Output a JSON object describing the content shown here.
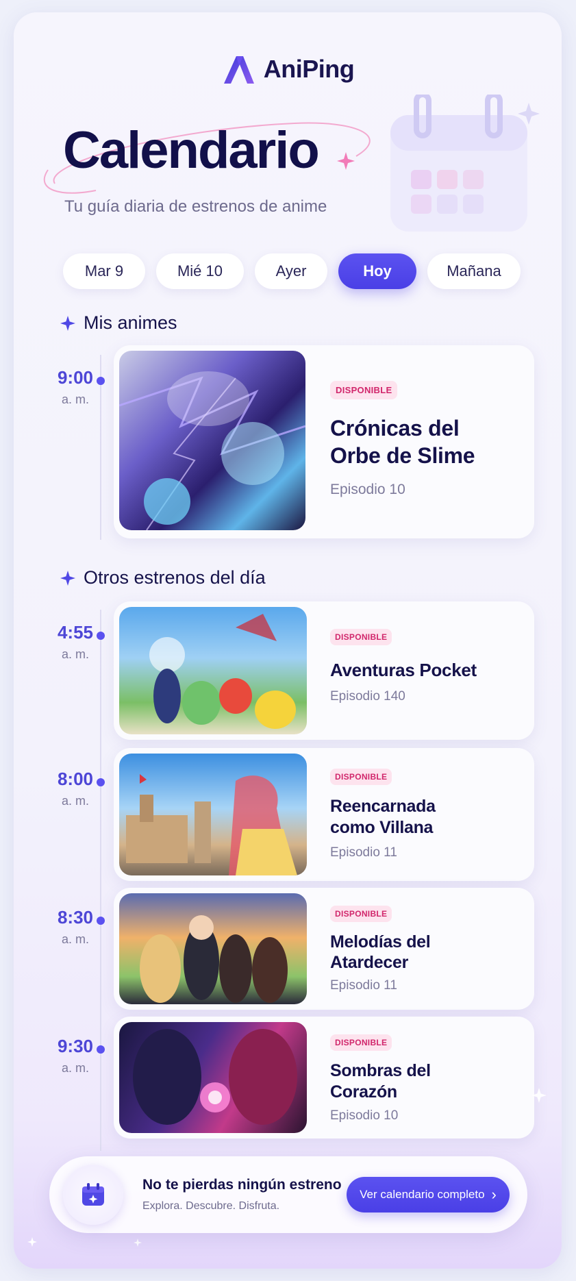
{
  "app": {
    "name": "AniPing"
  },
  "header": {
    "title": "Calendario",
    "subtitle": "Tu guía diaria de estrenos de anime"
  },
  "tabs": [
    {
      "label": "Mar 9",
      "active": false
    },
    {
      "label": "Mié 10",
      "active": false
    },
    {
      "label": "Ayer",
      "active": false
    },
    {
      "label": "Hoy",
      "active": true
    },
    {
      "label": "Mañana",
      "active": false
    }
  ],
  "sections": {
    "mine": "Mis animes",
    "others": "Otros estrenos del día"
  },
  "featured": {
    "time": "9:00",
    "meridiem": "a. m.",
    "badge": "DISPONIBLE",
    "title_line1": "Crónicas del",
    "title_line2": "Orbe de Slime",
    "episode": "Episodio 10"
  },
  "entries": [
    {
      "time": "4:55",
      "meridiem": "a. m.",
      "badge": "DISPONIBLE",
      "title_line1": "Aventuras Pocket",
      "title_line2": "",
      "episode": "Episodio 140"
    },
    {
      "time": "8:00",
      "meridiem": "a. m.",
      "badge": "DISPONIBLE",
      "title_line1": "Reencarnada",
      "title_line2": "como Villana",
      "episode": "Episodio 11"
    },
    {
      "time": "8:30",
      "meridiem": "a. m.",
      "badge": "DISPONIBLE",
      "title_line1": "Melodías del",
      "title_line2": "Atardecer",
      "episode": "Episodio 11"
    },
    {
      "time": "9:30",
      "meridiem": "a. m.",
      "badge": "DISPONIBLE",
      "title_line1": "Sombras del",
      "title_line2": "Corazón",
      "episode": "Episodio 10"
    }
  ],
  "banner": {
    "title": "No te pierdas ningún estreno",
    "subtitle": "Explora. Descubre. Disfruta.",
    "button": "Ver calendario completo",
    "chevron": "›"
  },
  "icons": {
    "logo": "aniping-logo-icon",
    "section": "sparkle-icon",
    "banner": "calendar-icon"
  },
  "colors": {
    "accent": "#5048e5",
    "badge_bg": "#fde3ee",
    "badge_text": "#d1266b",
    "title": "#15124a"
  }
}
